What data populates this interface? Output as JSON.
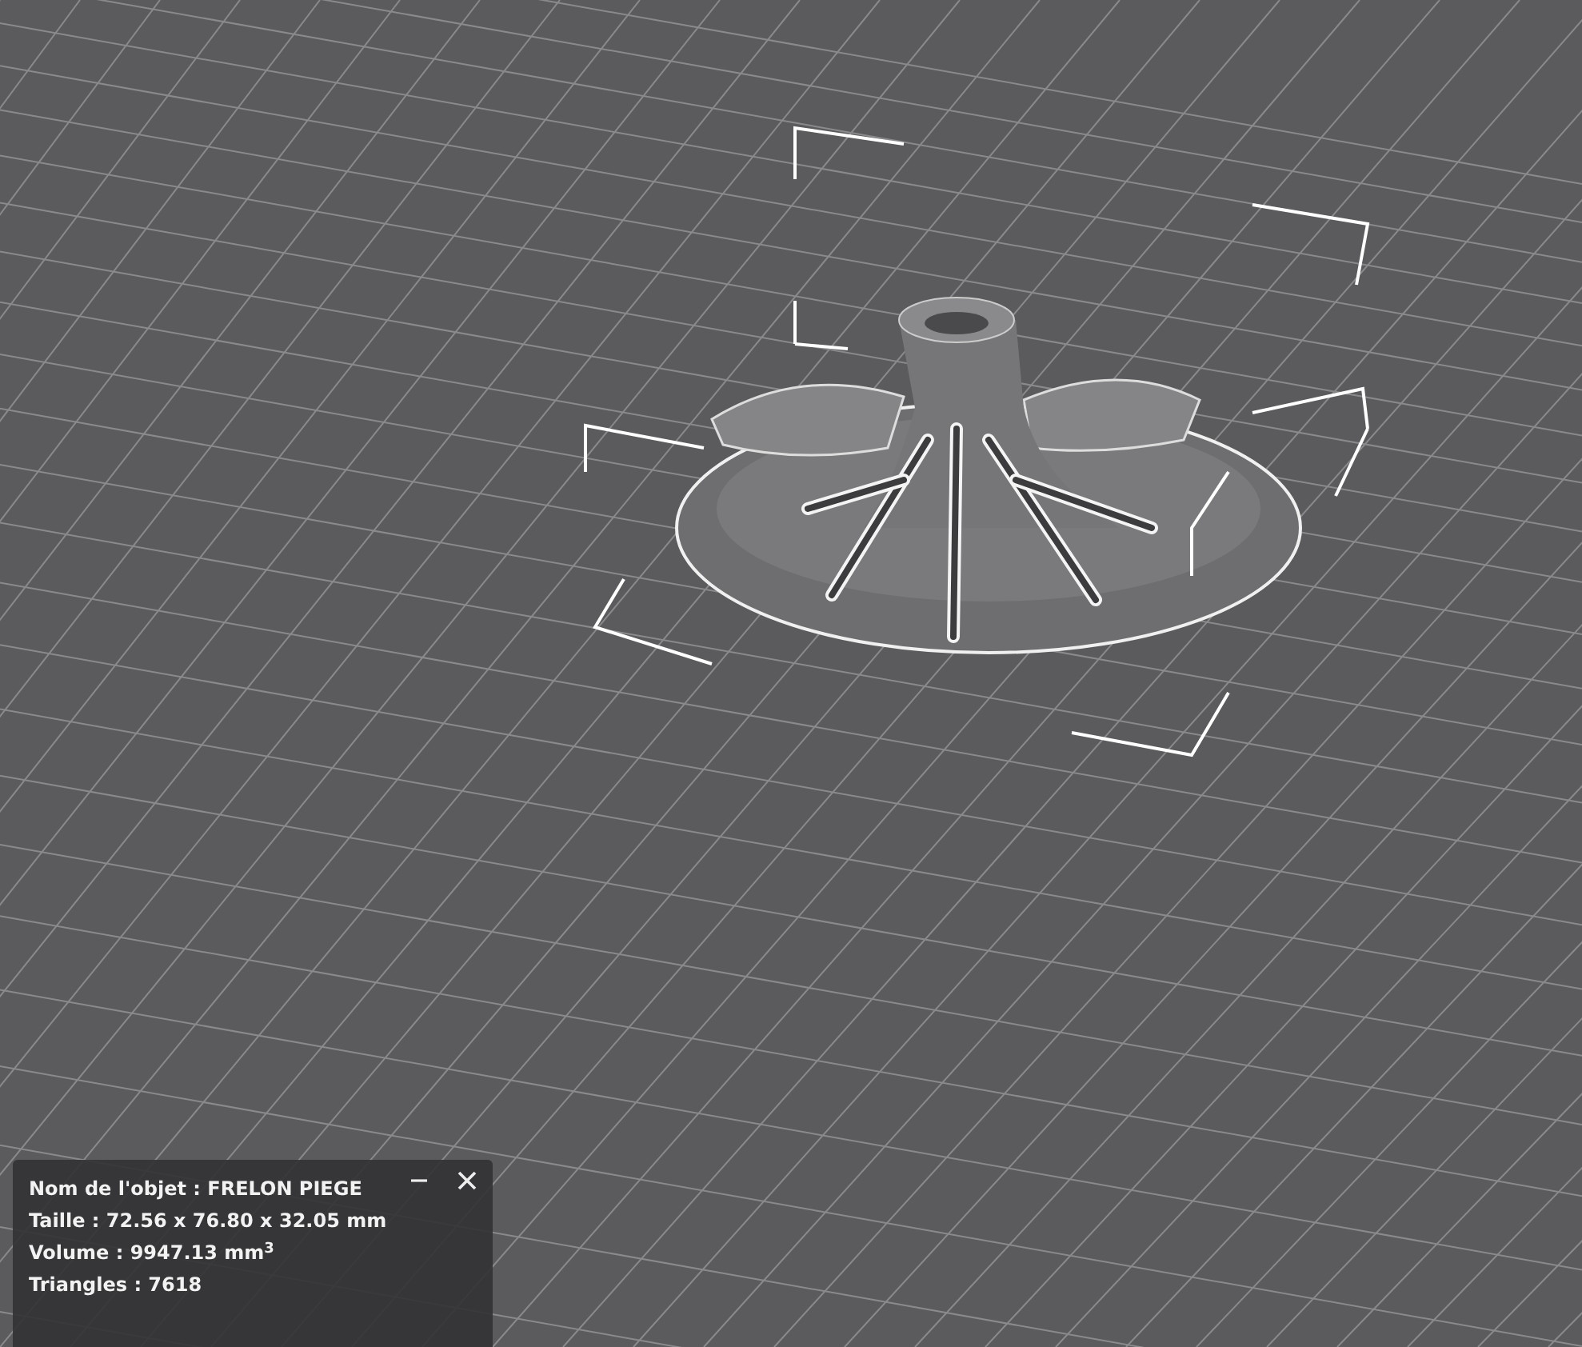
{
  "viewport": {
    "object_info": {
      "lines": [
        "Nom de l'objet : FRELON PIEGE",
        "Taille : 72.56 x 76.80 x 32.05 mm",
        "Volume : 9947.13 mm$^{3}$",
        "Triangles : 7618"
      ]
    }
  }
}
